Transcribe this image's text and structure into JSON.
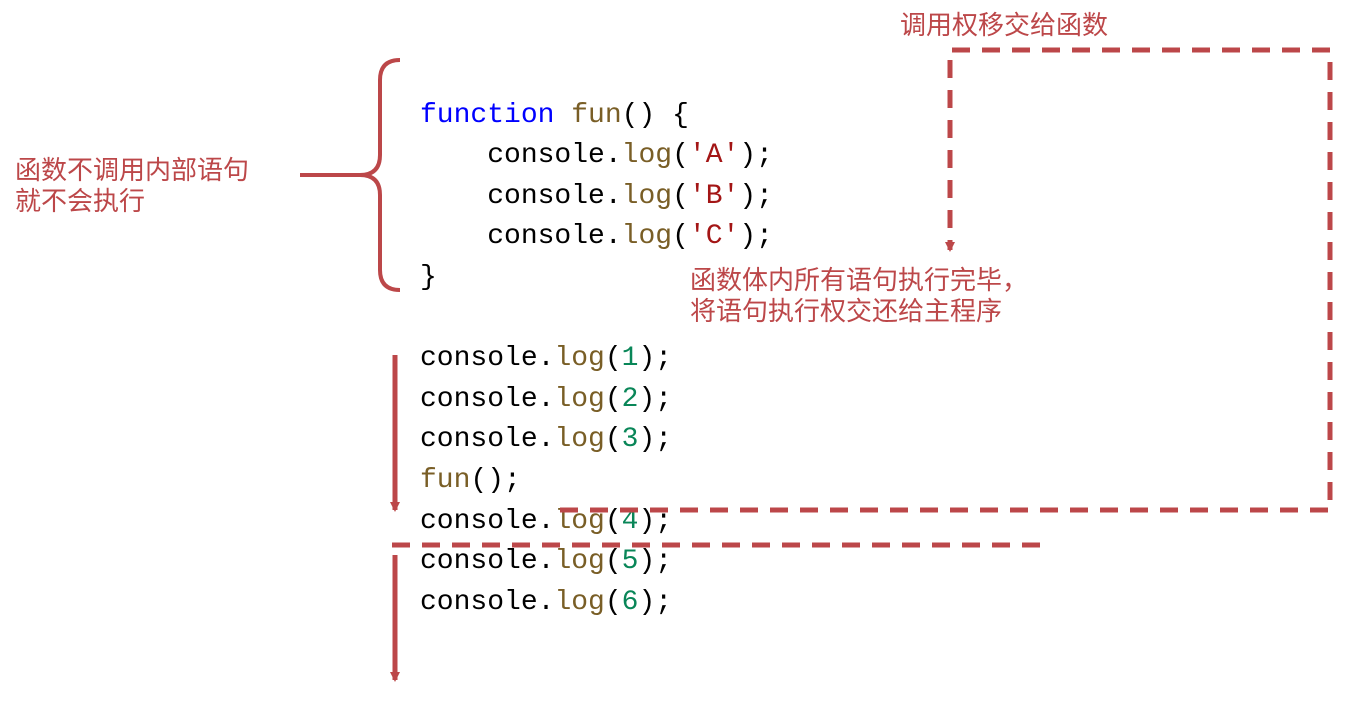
{
  "code": {
    "keyword_function": "function",
    "fun_name": "fun",
    "open_paren": "(",
    "close_paren": ")",
    "open_brace": "{",
    "close_brace": "}",
    "console": "console",
    "dot": ".",
    "log": "log",
    "strA": "'A'",
    "strB": "'B'",
    "strC": "'C'",
    "n1": "1",
    "n2": "2",
    "n3": "3",
    "n4": "4",
    "n5": "5",
    "n6": "6",
    "semi": ";",
    "fun_call": "fun"
  },
  "annotations": {
    "left_note": "函数不调用内部语句\n就不会执行",
    "top_right": "调用权移交给函数",
    "mid_right": "函数体内所有语句执行完毕，\n将语句执行权交还给主程序"
  },
  "colors": {
    "annotation": "#bc4749",
    "keyword": "#0000ff",
    "function": "#795e26",
    "string": "#a31515",
    "number": "#098658"
  }
}
